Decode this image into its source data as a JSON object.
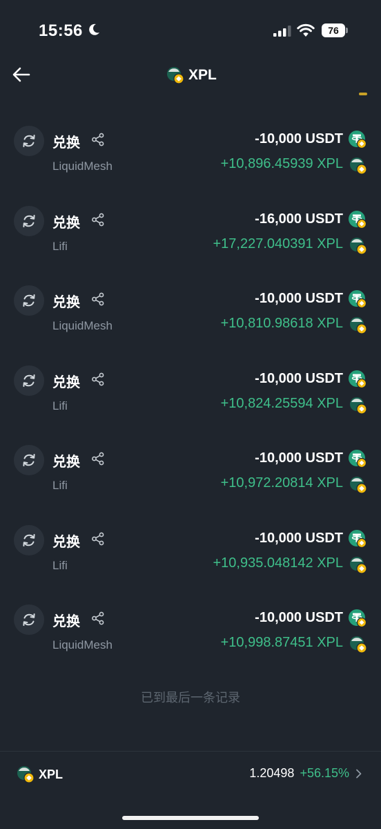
{
  "status": {
    "time": "15:56",
    "battery": "76"
  },
  "header": {
    "title": "XPL"
  },
  "transactions": [
    {
      "type": "兑换",
      "via": "LiquidMesh",
      "out": "-10,000 USDT",
      "in": "+10,896.45939 XPL"
    },
    {
      "type": "兑换",
      "via": "Lifi",
      "out": "-16,000 USDT",
      "in": "+17,227.040391 XPL"
    },
    {
      "type": "兑换",
      "via": "LiquidMesh",
      "out": "-10,000 USDT",
      "in": "+10,810.98618 XPL"
    },
    {
      "type": "兑换",
      "via": "Lifi",
      "out": "-10,000 USDT",
      "in": "+10,824.25594 XPL"
    },
    {
      "type": "兑换",
      "via": "Lifi",
      "out": "-10,000 USDT",
      "in": "+10,972.20814 XPL"
    },
    {
      "type": "兑换",
      "via": "Lifi",
      "out": "-10,000 USDT",
      "in": "+10,935.048142 XPL"
    },
    {
      "type": "兑换",
      "via": "LiquidMesh",
      "out": "-10,000 USDT",
      "in": "+10,998.87451 XPL"
    }
  ],
  "end_note": "已到最后一条记录",
  "footer": {
    "symbol": "XPL",
    "price": "1.20498",
    "change": "+56.15%"
  },
  "colors": {
    "background": "#1f252d",
    "positive": "#3fbf8a",
    "muted": "#8f98a3",
    "usdt": "#26a17b",
    "badge": "#f0b90b"
  },
  "icons": {
    "back": "arrow-left-icon",
    "share": "share-icon",
    "swap": "swap-icon",
    "usdt": "usdt-coin-icon",
    "xpl": "xpl-coin-icon",
    "chevron": "chevron-right-icon"
  }
}
